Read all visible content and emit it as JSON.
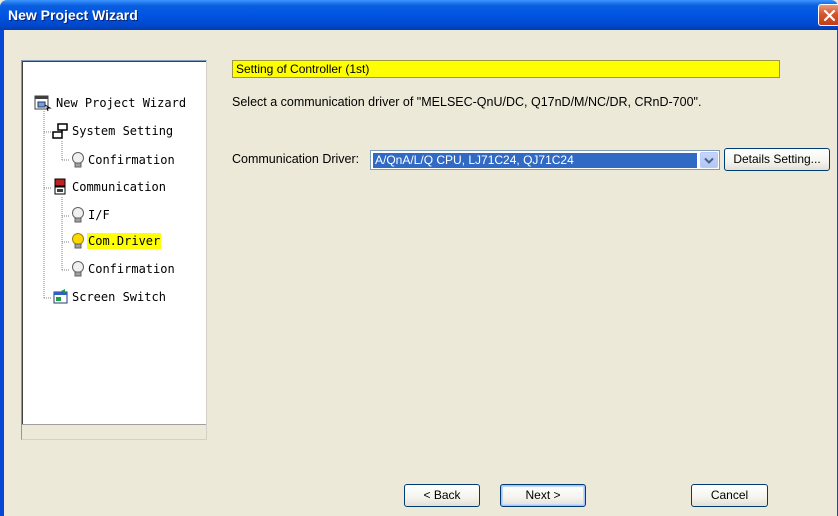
{
  "window": {
    "title": "New Project Wizard"
  },
  "tree": {
    "items": [
      {
        "label": "New Project Wizard",
        "icon": "wizard-icon"
      },
      {
        "label": "System Setting",
        "icon": "network-icon"
      },
      {
        "label": "Confirmation",
        "icon": "lightbulb-icon"
      },
      {
        "label": "Communication",
        "icon": "communication-icon"
      },
      {
        "label": "I/F",
        "icon": "lightbulb-icon"
      },
      {
        "label": "Com.Driver",
        "icon": "lightbulb-icon",
        "selected": true
      },
      {
        "label": "Confirmation",
        "icon": "lightbulb-icon"
      },
      {
        "label": "Screen Switch",
        "icon": "screen-switch-icon"
      }
    ]
  },
  "main": {
    "header": "Setting of Controller (1st)",
    "instruction": "Select a communication driver of \"MELSEC-QnU/DC, Q17nD/M/NC/DR, CRnD-700\".",
    "driver_label": "Communication Driver:",
    "driver_value": "A/QnA/L/Q CPU, LJ71C24, QJ71C24",
    "details_button": "Details Setting..."
  },
  "footer": {
    "back_button": "< Back",
    "next_button": "Next >",
    "cancel_button": "Cancel"
  },
  "colors": {
    "titlebar": "#0054e3",
    "header_highlight": "#ffff00",
    "selection": "#316ac5",
    "window_bg": "#ece9d8"
  }
}
